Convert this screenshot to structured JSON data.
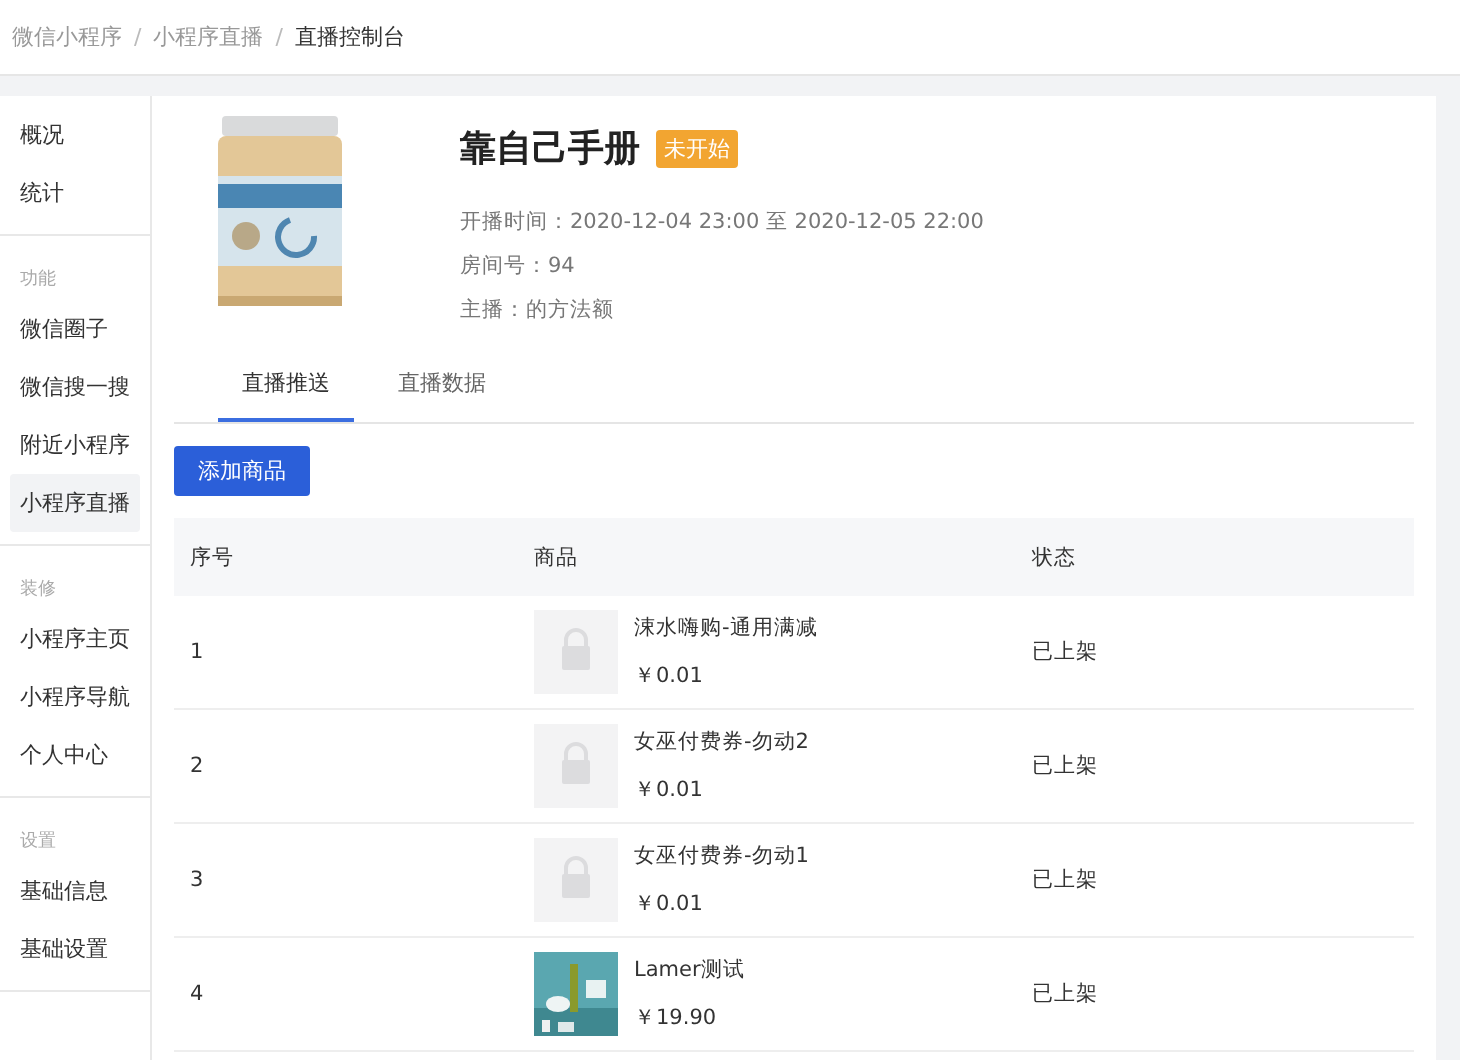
{
  "breadcrumb": [
    {
      "label": "微信小程序",
      "current": false
    },
    {
      "label": "小程序直播",
      "current": false
    },
    {
      "label": "直播控制台",
      "current": true
    }
  ],
  "breadcrumb_separator": "/",
  "sidebar": {
    "groups": [
      {
        "items": [
          {
            "label": "概况",
            "selected": false
          },
          {
            "label": "统计",
            "selected": false
          }
        ]
      },
      {
        "title": "功能",
        "items": [
          {
            "label": "微信圈子",
            "selected": false
          },
          {
            "label": "微信搜一搜",
            "selected": false
          },
          {
            "label": "附近小程序",
            "selected": false
          },
          {
            "label": "小程序直播",
            "selected": true
          }
        ]
      },
      {
        "title": "装修",
        "items": [
          {
            "label": "小程序主页",
            "selected": false
          },
          {
            "label": "小程序导航",
            "selected": false
          },
          {
            "label": "个人中心",
            "selected": false
          }
        ]
      },
      {
        "title": "设置",
        "items": [
          {
            "label": "基础信息",
            "selected": false
          },
          {
            "label": "基础设置",
            "selected": false
          }
        ]
      }
    ]
  },
  "room": {
    "title": "靠自己手册",
    "status_badge": "未开始",
    "info": [
      "开播时间：2020-12-04 23:00 至 2020-12-05 22:00",
      "房间号：94",
      "主播：的方法额"
    ]
  },
  "tabs": [
    {
      "label": "直播推送",
      "selected": true
    },
    {
      "label": "直播数据",
      "selected": false
    }
  ],
  "add_button": "添加商品",
  "table": {
    "columns": [
      "序号",
      "商品",
      "状态"
    ],
    "rows": [
      {
        "index": "1",
        "kind": "placeholder",
        "name": "涑水嗨购-通用满减",
        "price": "￥0.01",
        "status": "已上架"
      },
      {
        "index": "2",
        "kind": "placeholder",
        "name": "女巫付费券-勿动2",
        "price": "￥0.01",
        "status": "已上架"
      },
      {
        "index": "3",
        "kind": "placeholder",
        "name": "女巫付费券-勿动1",
        "price": "￥0.01",
        "status": "已上架"
      },
      {
        "index": "4",
        "kind": "picture",
        "name": "Lamer测试",
        "price": "￥19.90",
        "status": "已上架"
      }
    ]
  }
}
